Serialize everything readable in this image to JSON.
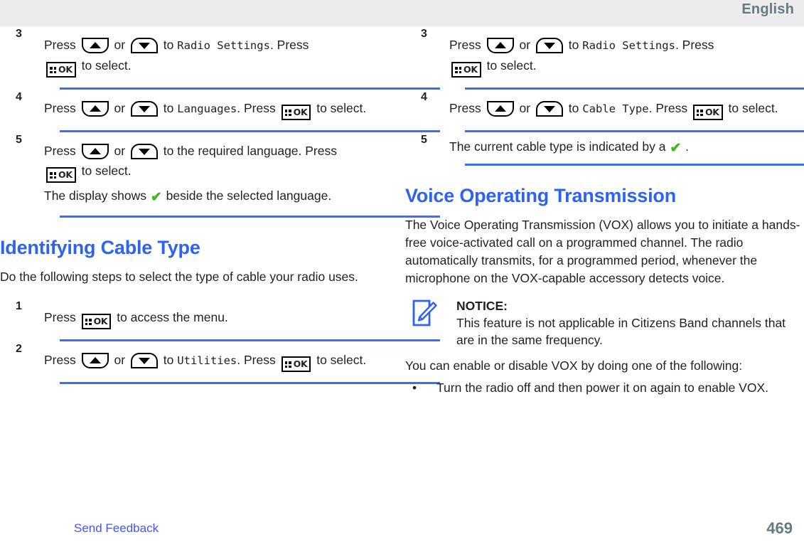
{
  "header": {
    "language_label": "English"
  },
  "footer": {
    "feedback_link": "Send Feedback",
    "page_number": "469"
  },
  "icons": {
    "up_button": "arrow-up-button-icon",
    "down_button": "arrow-down-button-icon",
    "ok_button": "menu-ok-button-icon",
    "ok_label": "OK",
    "checkmark": "green-checkmark-icon",
    "notice": "notice-pencil-icon",
    "bullet": "•"
  },
  "colors": {
    "heading_blue": "#2d63f0",
    "rule_blue": "#3b6ef5",
    "link_blue": "#4156f5",
    "header_gray": "#ececec",
    "header_text": "#657b82",
    "check_green": "#3cb820",
    "body_text": "#231f20"
  },
  "left_column": {
    "steps_language": [
      {
        "number": "3",
        "line1_a": "Press",
        "line1_or": "or",
        "line1_to": "to",
        "line1_menu": "Radio Settings",
        "line1_b": ". Press",
        "line2_a": "to select."
      },
      {
        "number": "4",
        "line1_a": "Press",
        "line1_or": "or",
        "line1_to": "to",
        "line1_menu": "Languages",
        "line1_b": ". Press",
        "line1_c": "to select."
      },
      {
        "number": "5",
        "line1_a": "Press",
        "line1_or": "or",
        "line1_to": "to the required language. Press",
        "line2_a": "to select.",
        "result_a": "The display shows",
        "result_b": "beside the selected language."
      }
    ],
    "section": {
      "heading": "Identifying Cable Type",
      "intro": "Do the following steps to select the type of cable your radio uses."
    },
    "steps_cable": [
      {
        "number": "1",
        "line1_a": "Press",
        "line1_b": "to access the menu."
      },
      {
        "number": "2",
        "line1_a": "Press",
        "line1_or": "or",
        "line1_to": "to",
        "line1_menu": "Utilities",
        "line1_b": ". Press",
        "line1_c": "to select."
      }
    ]
  },
  "right_column": {
    "steps_cable": [
      {
        "number": "3",
        "line1_a": "Press",
        "line1_or": "or",
        "line1_to": "to",
        "line1_menu": "Radio Settings",
        "line1_b": ". Press",
        "line2_a": "to select."
      },
      {
        "number": "4",
        "line1_a": "Press",
        "line1_or": "or",
        "line1_to": "to",
        "line1_menu": "Cable Type",
        "line1_b": ". Press",
        "line1_c": "to select."
      },
      {
        "number": "5",
        "result_a": "The current cable type is indicated by a",
        "result_b": "."
      }
    ],
    "section": {
      "heading": "Voice Operating Transmission",
      "paragraph": "The Voice Operating Transmission (VOX) allows you to initiate a hands-free voice-activated call on a programmed channel. The radio automatically transmits, for a programmed period, whenever the microphone on the VOX-capable accessory detects voice.",
      "notice_title": "NOTICE:",
      "notice_body": "This feature is not applicable in Citizens Band channels that are in the same frequency.",
      "paragraph2": "You can enable or disable VOX by doing one of the following:",
      "bullets": [
        "Turn the radio off and then power it on again to enable VOX."
      ]
    }
  }
}
